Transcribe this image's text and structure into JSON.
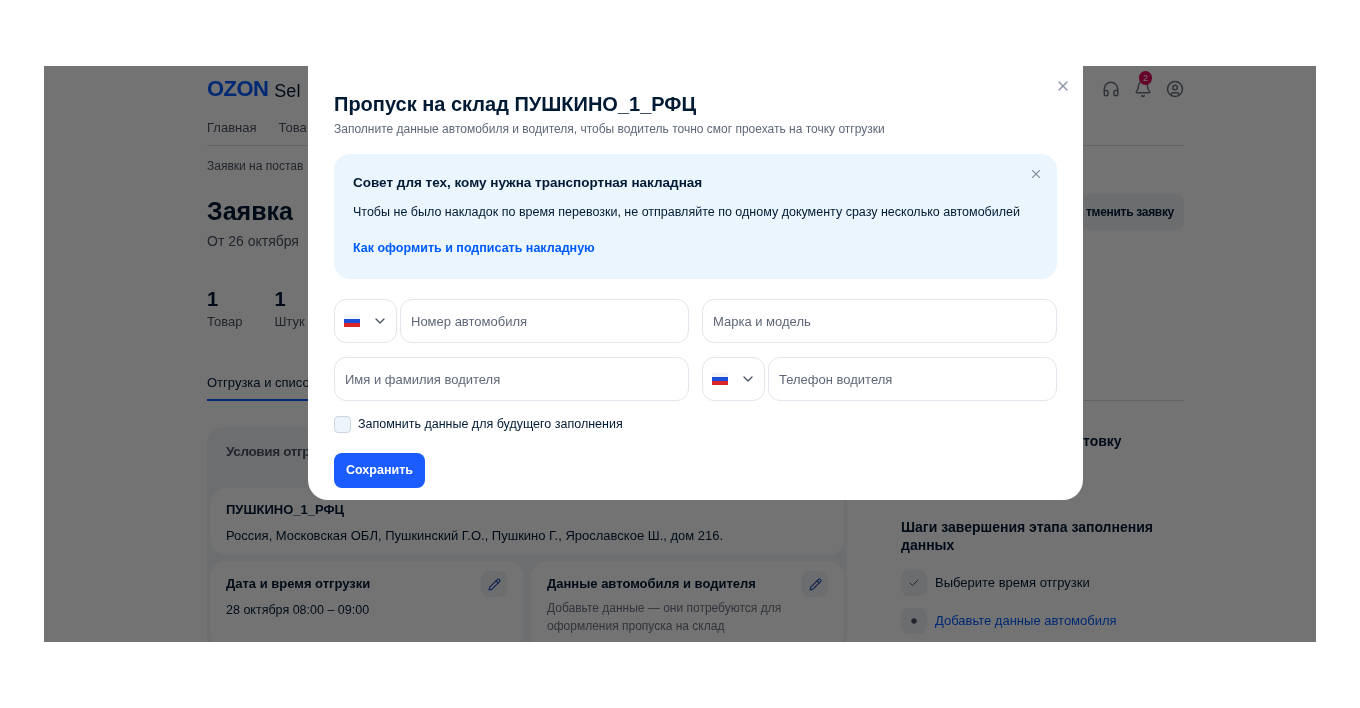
{
  "page": {
    "logo": "OZON",
    "logo_suffix": "Sel",
    "notifications_badge": "2",
    "nav": [
      "Главная",
      "Това"
    ],
    "breadcrumb": "Заявки на постав",
    "title": "Заявка",
    "date": "От 26 октября",
    "cancel_button": "тменить заявку",
    "stats": [
      {
        "value": "1",
        "label": "Товар"
      },
      {
        "value": "1",
        "label": "Штук"
      }
    ],
    "tabs": [
      {
        "label": "Отгрузка и списо",
        "selected": true
      }
    ],
    "conditions": {
      "title": "Условия отгр",
      "warehouse": "ПУШКИНО_1_РФЦ",
      "address": "Россия, Московская ОБЛ, Пушкинский Г.О., Пушкино Г., Ярославское Ш., дом 216.",
      "cards": [
        {
          "title": "Дата и время отгрузки",
          "text": "28 октября 08:00 – 09:00",
          "muted": false
        },
        {
          "title": "Данные автомобиля и водителя",
          "text": "Добавьте данные — они потребуются для оформления пропуска на склад",
          "muted": true
        }
      ]
    },
    "side_heading": "товку",
    "steps_title": "Шаги завершения этапа заполнения данных",
    "steps": [
      {
        "label": "Выберите время отгрузки",
        "done": true
      },
      {
        "label": "Добавьте данные автомобиля",
        "done": false
      }
    ]
  },
  "modal": {
    "title": "Пропуск на склад ПУШКИНО_1_РФЦ",
    "subtitle": "Заполните данные автомобиля и водителя, чтобы водитель точно смог проехать на точку отгрузки",
    "tip": {
      "title": "Совет для тех, кому нужна транспортная накладная",
      "text": "Чтобы не было накладок по время перевозки, не отправляйте по одному документу сразу несколько автомобилей",
      "link": "Как оформить и подписать накладную"
    },
    "fields": [
      {
        "kind": "country",
        "placeholder": "Номер автомобиля"
      },
      {
        "kind": "text",
        "placeholder": "Марка и модель"
      },
      {
        "kind": "text",
        "placeholder": "Имя и фамилия водителя"
      },
      {
        "kind": "country",
        "placeholder": "Телефон водителя"
      }
    ],
    "remember": {
      "label": "Запомнить данные для будущего заполнения",
      "checked": false
    },
    "save_button": "Сохранить"
  }
}
